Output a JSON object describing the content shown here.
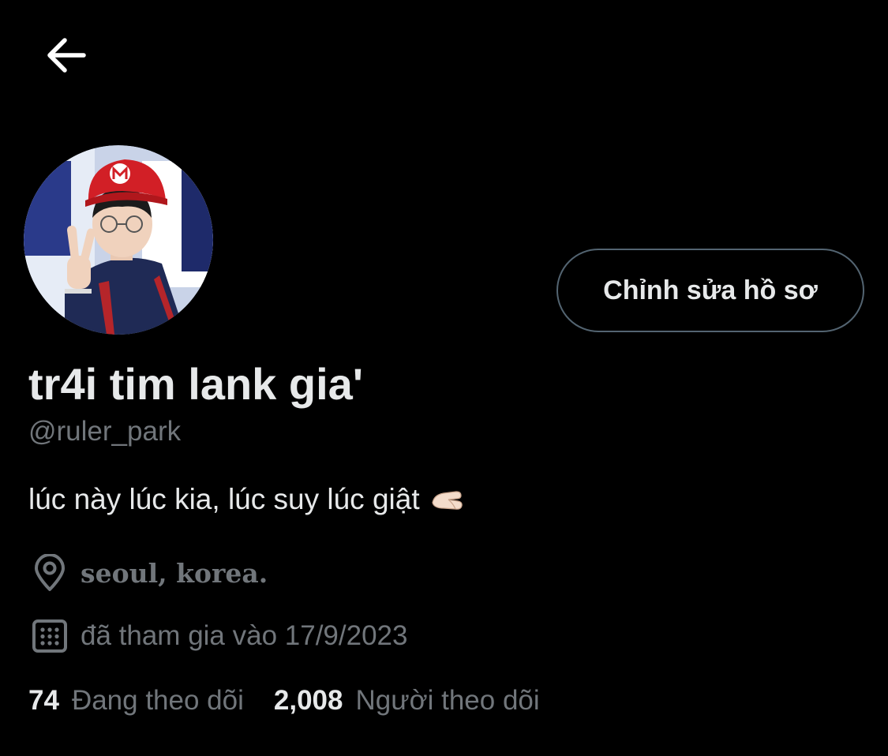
{
  "header": {
    "back_icon": "arrow-left-icon"
  },
  "profile": {
    "avatar_icon": "profile-photo",
    "edit_button_label": "Chỉnh sửa hồ sơ",
    "display_name": "tr4i tim lank gia'",
    "handle": "@ruler_park",
    "bio": "lúc này lúc kia, lúc suy lúc giật",
    "bio_emoji": "pinching-hand-emoji",
    "location_icon": "location-pin-icon",
    "location": "seoul, korea.",
    "joined_icon": "calendar-icon",
    "joined": "đã tham gia vào 17/9/2023"
  },
  "stats": {
    "following_count": "74",
    "following_label": "Đang theo dõi",
    "followers_count": "2,008",
    "followers_label": "Người theo dõi"
  },
  "colors": {
    "background": "#000000",
    "primary_text": "#e7e9ea",
    "secondary_text": "#71767b",
    "button_border": "#536471"
  }
}
